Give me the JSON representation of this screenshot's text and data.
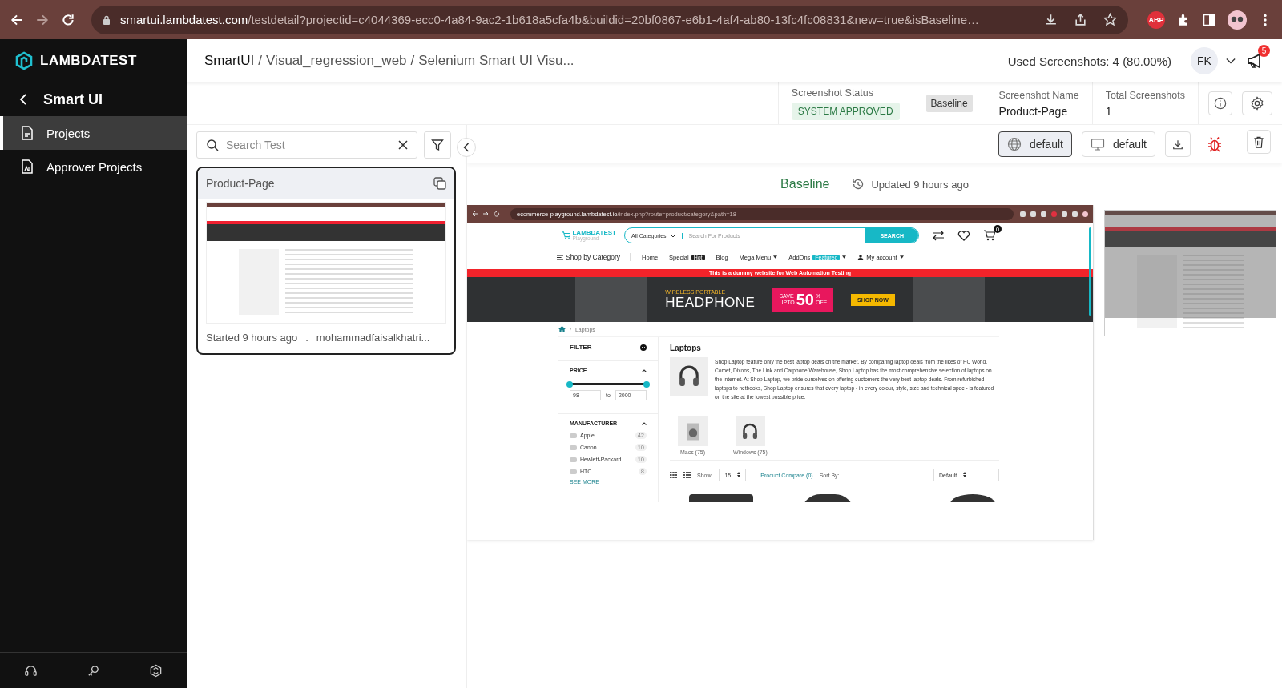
{
  "browser": {
    "url_host": "smartui.lambdatest.com",
    "url_path": "/testdetail?projectid=c4044369-ecc0-4a84-9ac2-1b618a5cfa4b&buildid=20bf0867-e6b1-4af4-ab80-13fc4fc08831&new=true&isBaseline…",
    "extension_badge": "ABP"
  },
  "sidebar": {
    "logo": "LAMBDATEST",
    "back_label": "Smart UI",
    "items": [
      {
        "label": "Projects",
        "kind": "doc",
        "selected": true
      },
      {
        "label": "Approver Projects",
        "kind": "approver",
        "selected": false
      }
    ]
  },
  "header": {
    "separator": "/",
    "breadcrumbs": [
      "SmartUI",
      "Visual_regression_web",
      "Selenium Smart UI Visu..."
    ],
    "usage": "Used Screenshots: 4 (80.00%)",
    "avatar": "FK",
    "notifications": "5"
  },
  "info": {
    "status_label": "Screenshot Status",
    "status": "SYSTEM APPROVED",
    "tag": "Baseline",
    "name_label": "Screenshot Name",
    "name": "Product-Page",
    "total_label": "Total Screenshots",
    "total": "1"
  },
  "search": {
    "placeholder": "Search Test"
  },
  "tests": [
    {
      "name": "Product-Page",
      "started": "Started 9 hours ago",
      "separator": ".",
      "author": "mohammadfaisalkhatri...",
      "selected": true
    }
  ],
  "toolbar": [
    {
      "kind": "browser",
      "label": "default",
      "selected": true
    },
    {
      "kind": "device",
      "label": "default",
      "selected": false
    }
  ],
  "view": {
    "title": "Baseline",
    "updated": "Updated 9 hours ago"
  },
  "capture": {
    "url_host": "ecommerce-playground.lambdatest.io",
    "url_path": "/index.php?route=product/category&path=18",
    "logo": "LAMBDATEST",
    "logo_sub": "Playground",
    "categories": "All Categories",
    "search_placeholder": "Search For Products",
    "search_button": "SEARCH",
    "cart_count": "0",
    "nav": [
      {
        "kind": "category",
        "label": "Shop by Category"
      },
      {
        "kind": "link",
        "label": "Home"
      },
      {
        "kind": "link",
        "label": "Special",
        "badge": {
          "text": "Hot",
          "color": "#222222"
        }
      },
      {
        "kind": "link",
        "label": "Blog"
      },
      {
        "kind": "dropdown",
        "label": "Mega Menu"
      },
      {
        "kind": "dropdown",
        "label": "AddOns",
        "badge": {
          "text": "Featured",
          "color": "#17b8c6"
        }
      },
      {
        "kind": "account",
        "label": "My account"
      }
    ],
    "notice": "This is a dummy website for Web Automation Testing",
    "banner": {
      "eyebrow": "WIRELESS PORTABLE",
      "title": "HEADPHONE",
      "save": "SAVE",
      "upto": "UPTO",
      "percent": "50",
      "percent_sign": "%",
      "off": "OFF",
      "cta": "SHOP NOW"
    },
    "breadcrumb_separator": "/",
    "breadcrumb": "Laptops",
    "filter": {
      "title": "FILTER",
      "price_label": "PRICE",
      "price_slider": {
        "level": 1
      },
      "min": "98",
      "to": "to",
      "max": "2000",
      "manufacturer_label": "MANUFACTURER",
      "manufacturers": [
        {
          "name": "Apple",
          "count": "42"
        },
        {
          "name": "Canon",
          "count": "10"
        },
        {
          "name": "Hewlett-Packard",
          "count": "10"
        },
        {
          "name": "HTC",
          "count": "8"
        }
      ],
      "see_more": "SEE MORE"
    },
    "category": {
      "title": "Laptops",
      "description": "Shop Laptop feature only the best laptop deals on the market. By comparing laptop deals from the likes of PC World, Comet, Dixons, The Link and Carphone Warehouse, Shop Laptop has the most comprehensive selection of laptops on the internet. At Shop Laptop, we pride ourselves on offering customers the very best laptop deals. From refurbished laptops to netbooks, Shop Laptop ensures that every laptop - in every colour, style, size and technical spec - is featured on the site at the lowest possible price.",
      "subcategories": [
        {
          "kind": "washer",
          "label": "Macs (75)"
        },
        {
          "kind": "headphone",
          "label": "Windows (75)"
        }
      ],
      "show_label": "Show:",
      "show_value": "15",
      "compare": "Product Compare (0)",
      "sort_label": "Sort By:",
      "sort_value": "Default"
    }
  }
}
